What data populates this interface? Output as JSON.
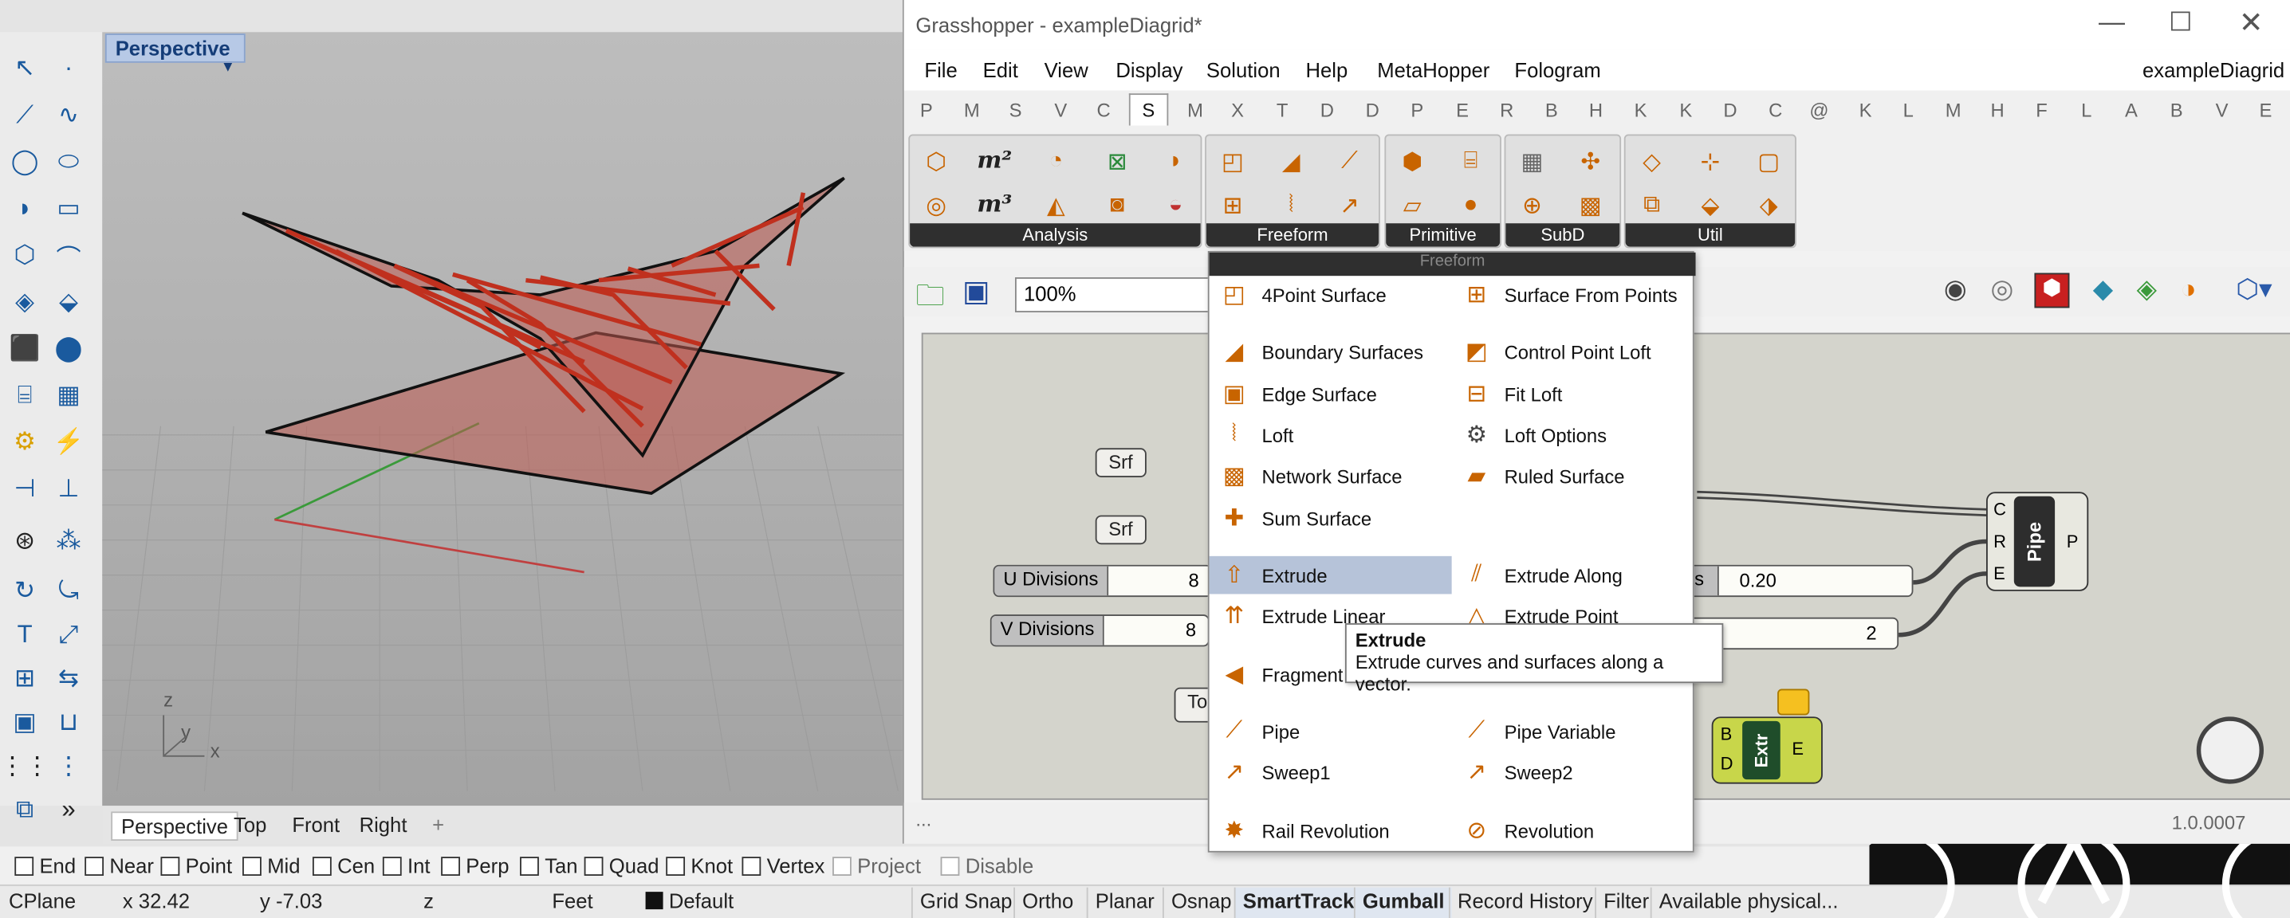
{
  "rhino": {
    "viewport_label": "Perspective",
    "view_tabs": [
      "Perspective",
      "Top",
      "Front",
      "Right"
    ],
    "add_tab": "+",
    "axis_z": "z",
    "axis_y": "y",
    "axis_x": "x",
    "osnaps": [
      "End",
      "Near",
      "Point",
      "Mid",
      "Cen",
      "Int",
      "Perp",
      "Tan",
      "Quad",
      "Knot",
      "Vertex",
      "Project",
      "Disable"
    ],
    "status": {
      "cplane": "CPlane",
      "x": "x 32.42",
      "y": "y -7.03",
      "z": "z",
      "units": "Feet",
      "layer": "Default"
    },
    "status_buttons": [
      "Grid Snap",
      "Ortho",
      "Planar",
      "Osnap",
      "SmartTrack",
      "Gumball",
      "Record History",
      "Filter",
      "Available physical..."
    ]
  },
  "gh": {
    "title": "Grasshopper - exampleDiagrid*",
    "doc_name": "exampleDiagrid",
    "menu": [
      "File",
      "Edit",
      "View",
      "Display",
      "Solution",
      "Help",
      "MetaHopper",
      "Fologram"
    ],
    "tabs": [
      "P",
      "M",
      "S",
      "V",
      "C",
      "S",
      "M",
      "X",
      "T",
      "D",
      "D",
      "P",
      "E",
      "R",
      "B",
      "H",
      "K",
      "K",
      "D",
      "C",
      "@",
      "K",
      "L",
      "M",
      "H",
      "F",
      "L",
      "A",
      "B",
      "V",
      "E"
    ],
    "groups": [
      "Analysis",
      "Freeform",
      "Primitive",
      "SubD",
      "Util"
    ],
    "zoom": "100%",
    "components": {
      "srf1": "Srf",
      "srf2": "Srf",
      "u_div_label": "U Divisions",
      "u_div_val": "8",
      "v_div_label": "V Divisions",
      "v_div_val": "8",
      "radius_label": "us",
      "radius_val": "0.20",
      "count_val": "2",
      "to_label": "To",
      "pipe_label": "Pipe",
      "pipe_in": [
        "C",
        "R",
        "E"
      ],
      "pipe_out": "P",
      "extr_label": "Extr",
      "extr_in": [
        "B",
        "D"
      ],
      "extr_out": "E"
    },
    "status_left": "...",
    "version": "1.0.0007"
  },
  "dropdown": {
    "header": "Freeform",
    "left": [
      "4Point Surface",
      "Boundary Surfaces",
      "Edge Surface",
      "Loft",
      "Network Surface",
      "Sum Surface",
      "Extrude",
      "Extrude Linear",
      "Fragment Patch",
      "Pipe",
      "Sweep1",
      "Rail Revolution"
    ],
    "right": [
      "Surface From Points",
      "Control Point Loft",
      "Fit Loft",
      "Loft Options",
      "Ruled Surface",
      "Extrude Along",
      "Extrude Point",
      "",
      "Pipe Variable",
      "Sweep2",
      "Revolution"
    ],
    "tooltip_title": "Extrude",
    "tooltip_text": "Extrude curves and surfaces along a vector."
  },
  "colors": {
    "accent": "#b7c9e6",
    "highlight": "#b6c3d9",
    "mesh": "#c0301e"
  }
}
